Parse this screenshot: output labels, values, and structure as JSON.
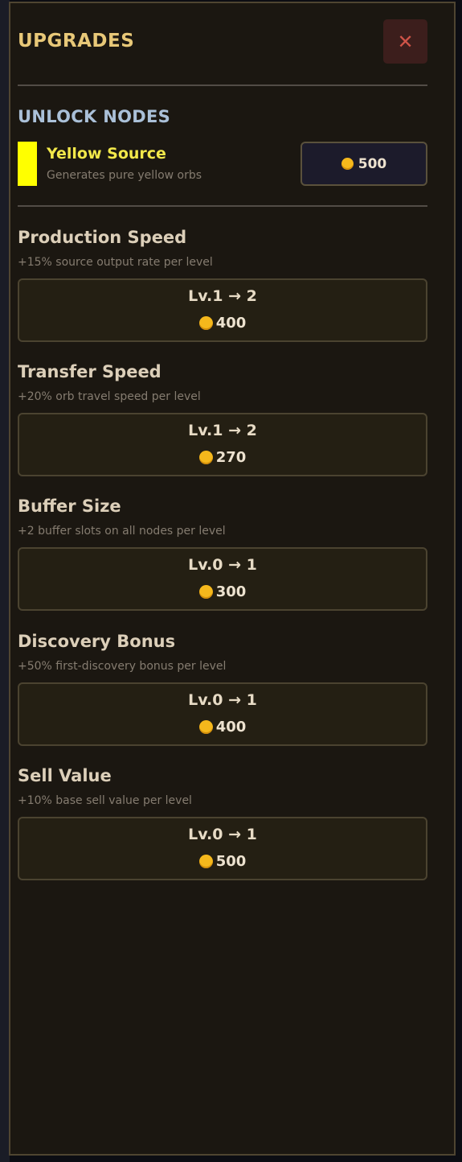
{
  "panel": {
    "title": "UPGRADES",
    "close_symbol": "✕",
    "close_icon": "close-icon"
  },
  "unlock_section": {
    "title": "UNLOCK NODES",
    "items": [
      {
        "name": "Yellow Source",
        "description": "Generates pure yellow orbs",
        "swatch_color": "#ffff00",
        "cost": "500",
        "cost_icon": "coin-icon"
      }
    ]
  },
  "upgrades": [
    {
      "name": "Production Speed",
      "description": "+15% source output rate per level",
      "level": "Lv.1 → 2",
      "cost": "400"
    },
    {
      "name": "Transfer Speed",
      "description": "+20% orb travel speed per level",
      "level": "Lv.1 → 2",
      "cost": "270"
    },
    {
      "name": "Buffer Size",
      "description": "+2 buffer slots on all nodes per level",
      "level": "Lv.0 → 1",
      "cost": "300"
    },
    {
      "name": "Discovery Bonus",
      "description": "+50% first-discovery bonus per level",
      "level": "Lv.0 → 1",
      "cost": "400"
    },
    {
      "name": "Sell Value",
      "description": "+10% base sell value per level",
      "level": "Lv.0 → 1",
      "cost": "500"
    }
  ],
  "colors": {
    "panel_bg": "#1b1711",
    "accent_gold": "#e8c878",
    "section_blue": "#aac0d8",
    "coin": "#f5b81c",
    "close_red": "#d05448"
  }
}
